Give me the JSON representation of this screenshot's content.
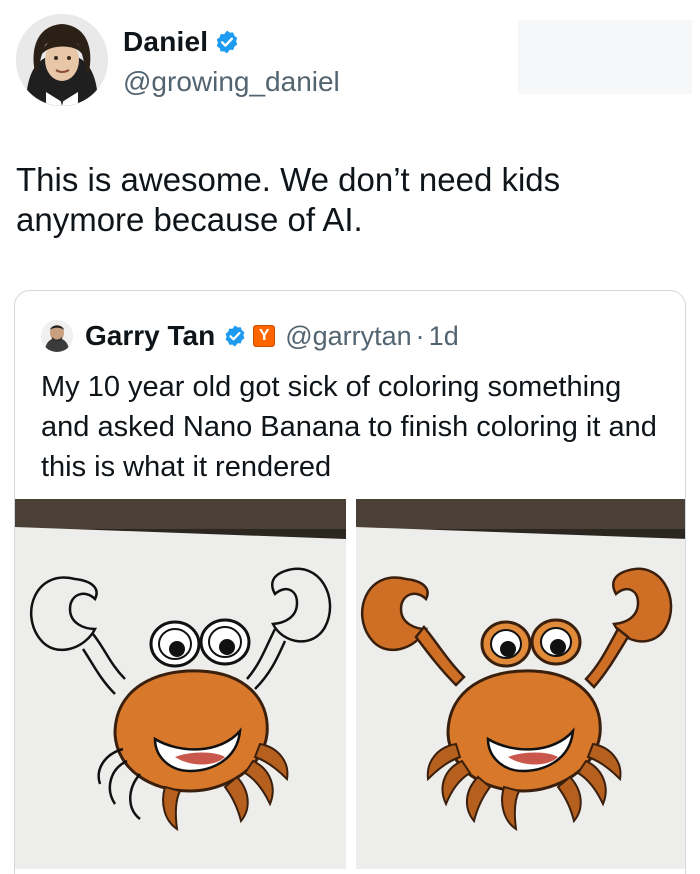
{
  "author": {
    "display_name": "Daniel",
    "handle": "@growing_daniel",
    "verified": true
  },
  "tweet": {
    "text": "This is awesome. We don’t need kids anymore because of AI."
  },
  "quoted_tweet": {
    "display_name": "Garry Tan",
    "verified": true,
    "affiliate_badge": "Y",
    "handle": "@garrytan",
    "separator": "·",
    "time": "1d",
    "text": "My 10 year old got sick of coloring something and asked Nano Banana to finish coloring it and this is what it rendered",
    "media": [
      {
        "name": "partially colored crab drawing"
      },
      {
        "name": "fully colored crab drawing"
      }
    ]
  },
  "colors": {
    "verified_blue": "#1d9bf0",
    "yc_orange": "#ff6600",
    "crab_orange": "#d8782a",
    "muted_text": "#536471"
  }
}
